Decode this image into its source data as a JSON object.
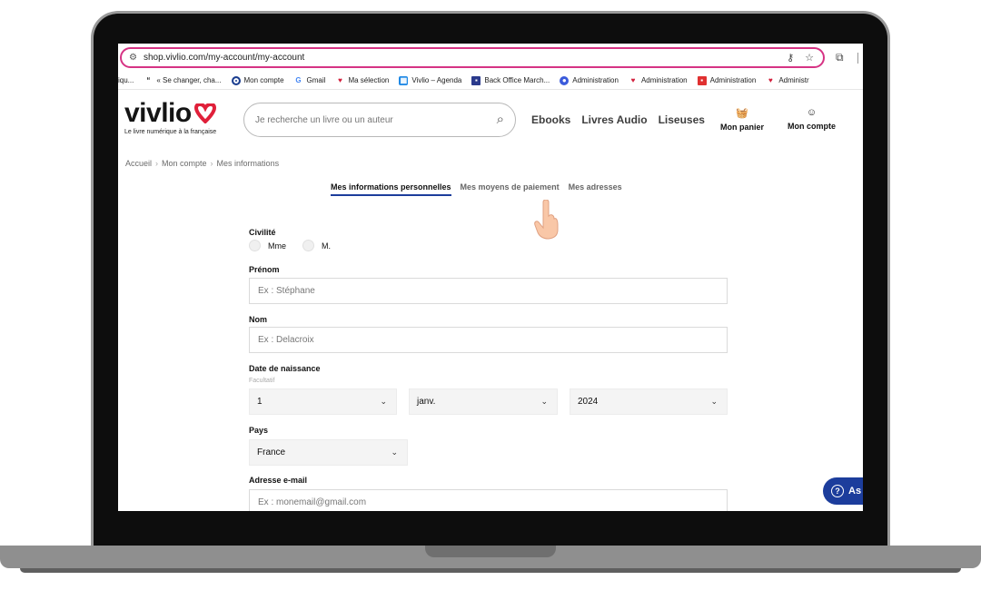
{
  "browser": {
    "url": "shop.vivlio.com/my-account/my-account",
    "bookmarks": [
      {
        "label": "iqu...",
        "icon": "none"
      },
      {
        "label": "« Se changer, cha...",
        "icon": "quote-icon"
      },
      {
        "label": "Mon compte",
        "icon": "circle-icon"
      },
      {
        "label": "Gmail",
        "icon": "google-icon"
      },
      {
        "label": "Ma sélection",
        "icon": "vivlio-heart-icon"
      },
      {
        "label": "Vivlio – Agenda",
        "icon": "calendar-icon"
      },
      {
        "label": "Back Office March...",
        "icon": "pz-icon"
      },
      {
        "label": "Administration",
        "icon": "p-icon"
      },
      {
        "label": "Administration",
        "icon": "vivlio-heart-icon"
      },
      {
        "label": "Administration",
        "icon": "red-square-icon"
      },
      {
        "label": "Administr",
        "icon": "vivlio-heart-icon"
      }
    ]
  },
  "header": {
    "logo_text": "vivlio",
    "logo_tagline": "Le livre numérique à la française",
    "search_placeholder": "Je recherche un livre ou un auteur",
    "nav": [
      "Ebooks",
      "Livres Audio",
      "Liseuses"
    ],
    "cart_label": "Mon panier",
    "account_label": "Mon compte"
  },
  "breadcrumb": [
    "Accueil",
    "Mon compte",
    "Mes informations"
  ],
  "tabs": [
    {
      "label": "Mes informations personnelles",
      "active": true
    },
    {
      "label": "Mes moyens de paiement",
      "active": false
    },
    {
      "label": "Mes adresses",
      "active": false
    }
  ],
  "form": {
    "civilite_label": "Civilité",
    "civilite_options": [
      "Mme",
      "M."
    ],
    "prenom_label": "Prénom",
    "prenom_placeholder": "Ex : Stéphane",
    "nom_label": "Nom",
    "nom_placeholder": "Ex : Delacroix",
    "naissance_label": "Date de naissance",
    "naissance_optional": "Facultatif",
    "day_value": "1",
    "month_value": "janv.",
    "year_value": "2024",
    "pays_label": "Pays",
    "pays_value": "France",
    "email_label": "Adresse e-mail",
    "email_placeholder": "Ex : monemail@gmail.com"
  },
  "assistant": {
    "label": "As"
  },
  "colors": {
    "brand_red": "#e0203a",
    "brand_blue": "#1c3d9c",
    "highlight": "#d63384"
  }
}
